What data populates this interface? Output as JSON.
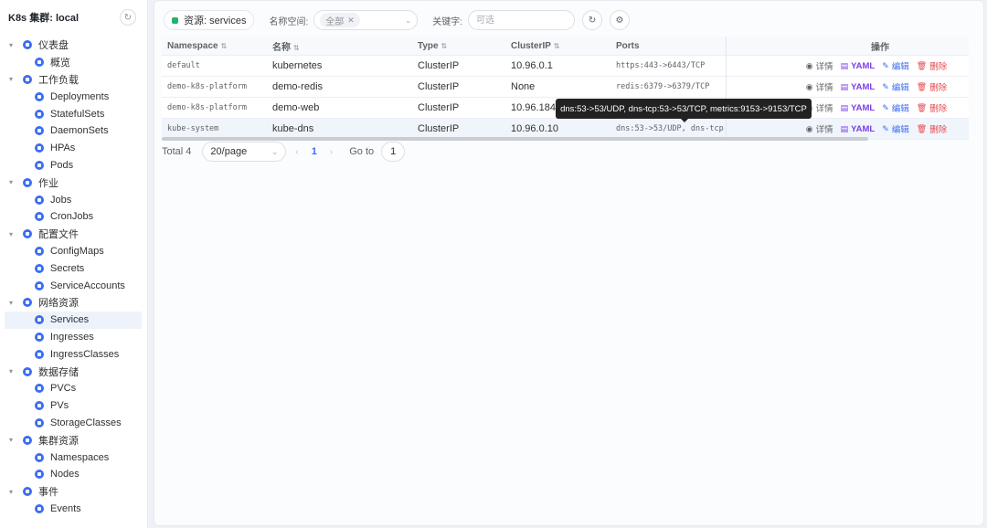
{
  "sidebar": {
    "title": "K8s 集群: local",
    "groups": [
      {
        "label": "仪表盘",
        "items": [
          "概览"
        ]
      },
      {
        "label": "工作负载",
        "items": [
          "Deployments",
          "StatefulSets",
          "DaemonSets",
          "HPAs",
          "Pods"
        ]
      },
      {
        "label": "作业",
        "items": [
          "Jobs",
          "CronJobs"
        ]
      },
      {
        "label": "配置文件",
        "items": [
          "ConfigMaps",
          "Secrets",
          "ServiceAccounts"
        ]
      },
      {
        "label": "网络资源",
        "items": [
          "Services",
          "Ingresses",
          "IngressClasses"
        ]
      },
      {
        "label": "数据存储",
        "items": [
          "PVCs",
          "PVs",
          "StorageClasses"
        ]
      },
      {
        "label": "集群资源",
        "items": [
          "Namespaces",
          "Nodes"
        ]
      },
      {
        "label": "事件",
        "items": [
          "Events"
        ]
      }
    ],
    "active": "Services"
  },
  "toolbar": {
    "resource_label": "资源: services",
    "namespace_label": "名称空间:",
    "namespace_value": "全部",
    "keyword_label": "关键字:",
    "keyword_placeholder": "可选"
  },
  "table": {
    "headers": [
      "Namespace",
      "名称",
      "Type",
      "ClusterIP",
      "Ports",
      "操作"
    ],
    "rows": [
      {
        "namespace": "default",
        "name": "kubernetes",
        "type": "ClusterIP",
        "cluster_ip": "10.96.0.1",
        "ports": "https:443->6443/TCP"
      },
      {
        "namespace": "demo-k8s-platform",
        "name": "demo-redis",
        "type": "ClusterIP",
        "cluster_ip": "None",
        "ports": "redis:6379->6379/TCP"
      },
      {
        "namespace": "demo-k8s-platform",
        "name": "demo-web",
        "type": "ClusterIP",
        "cluster_ip": "10.96.184.16",
        "ports": ""
      },
      {
        "namespace": "kube-system",
        "name": "kube-dns",
        "type": "ClusterIP",
        "cluster_ip": "10.96.0.10",
        "ports": "dns:53->53/UDP, dns-tcp"
      }
    ],
    "actions": {
      "detail": "详情",
      "yaml": "YAML",
      "edit": "编辑",
      "delete": "删除"
    }
  },
  "tooltip": "dns:53->53/UDP, dns-tcp:53->53/TCP, metrics:9153->9153/TCP",
  "pagination": {
    "total": "Total 4",
    "page_size": "20/page",
    "current_page": "1",
    "goto_label": "Go to",
    "goto_value": "1"
  }
}
